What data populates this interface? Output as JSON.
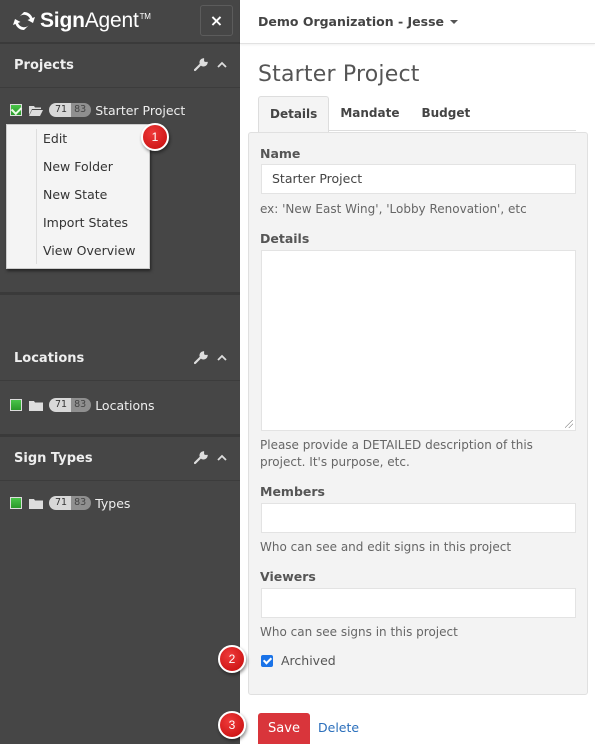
{
  "sidebar": {
    "brand": {
      "bold": "Sign",
      "light": "Agent",
      "tm": "TM"
    },
    "close_label": "×",
    "sections": [
      {
        "title": "Projects",
        "tree": {
          "label": "Starter Project",
          "count_a": "71",
          "count_b": "83",
          "checked": true,
          "folder": "open"
        },
        "context_menu": [
          "Edit",
          "New Folder",
          "New State",
          "Import States",
          "View Overview"
        ]
      },
      {
        "title": "Locations",
        "tree": {
          "label": "Locations",
          "count_a": "71",
          "count_b": "83",
          "checked": false,
          "folder": "closed"
        }
      },
      {
        "title": "Sign Types",
        "tree": {
          "label": "Types",
          "count_a": "71",
          "count_b": "83",
          "checked": false,
          "folder": "closed"
        }
      }
    ]
  },
  "topbar": {
    "org_label": "Demo Organization - Jesse"
  },
  "main": {
    "title": "Starter Project",
    "tabs": [
      {
        "label": "Details",
        "active": true
      },
      {
        "label": "Mandate",
        "active": false
      },
      {
        "label": "Budget",
        "active": false
      }
    ],
    "form": {
      "name_label": "Name",
      "name_value": "Starter Project",
      "name_help": "ex: 'New East Wing', 'Lobby Renovation', etc",
      "details_label": "Details",
      "details_value": "",
      "details_help": "Please provide a DETAILED description of this project. It's purpose, etc.",
      "members_label": "Members",
      "members_value": "",
      "members_help": "Who can see and edit signs in this project",
      "viewers_label": "Viewers",
      "viewers_value": "",
      "viewers_help": "Who can see signs in this project",
      "archived_label": "Archived",
      "archived_checked": true
    },
    "actions": {
      "save_label": "Save",
      "delete_label": "Delete"
    }
  },
  "markers": [
    "1",
    "2",
    "3"
  ],
  "colors": {
    "sidebar_bg": "#464646",
    "save_red": "#d9353b",
    "link_blue": "#2a6ebb",
    "marker_red": "#d51818",
    "checkbox_blue": "#1a73e8"
  }
}
